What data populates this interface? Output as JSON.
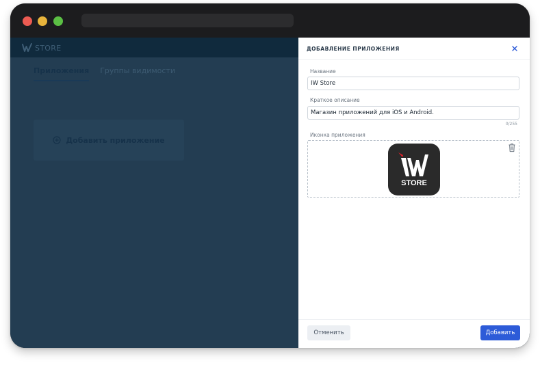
{
  "window": {
    "controls": [
      "close",
      "minimize",
      "maximize"
    ]
  },
  "header": {
    "logo_text": "STORE",
    "logo_icon": "iw-logo-icon"
  },
  "tabs": [
    {
      "label": "Приложения",
      "active": true
    },
    {
      "label": "Группы видимости",
      "active": false
    }
  ],
  "main": {
    "add_app_label": "Добавить приложение",
    "add_app_icon": "plus-circle-icon"
  },
  "drawer": {
    "title": "ДОБАВЛЕНИЕ ПРИЛОЖЕНИЯ",
    "close_icon": "close-icon",
    "name_label": "Название",
    "name_value": "IW Store",
    "desc_label": "Краткое описание",
    "desc_value": "Магазин приложений для iOS и Android.",
    "desc_counter": "0/255",
    "icon_label": "Иконка приложения",
    "icon_text": "STORE",
    "delete_icon": "trash-icon",
    "cancel_label": "Отменить",
    "add_label": "Добавить"
  },
  "colors": {
    "overlay": "#233d52",
    "topbar": "#102a3d",
    "primary_button": "#2d5bd8",
    "app_icon_bg": "#2a2a2a",
    "app_icon_accent": "#e0202a"
  }
}
